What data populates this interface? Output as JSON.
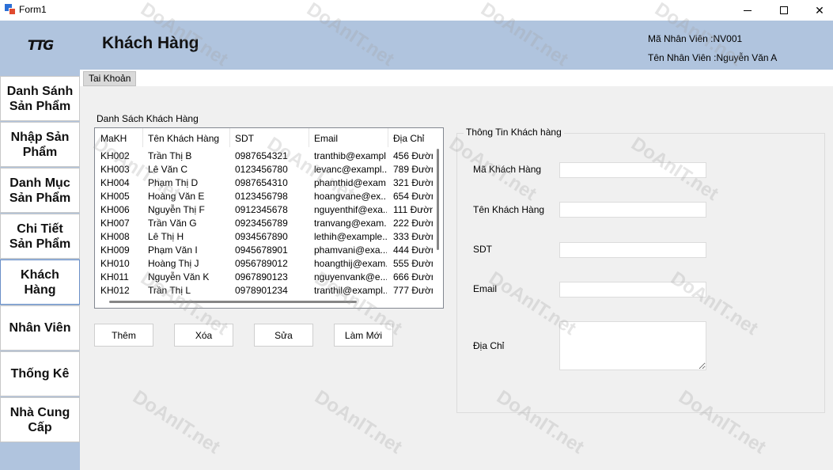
{
  "window": {
    "title": "Form1",
    "icon": "winforms-app-icon",
    "controls": [
      "minimize-icon",
      "maximize-icon",
      "close-icon"
    ]
  },
  "sidebar": {
    "logo_text": "TTG",
    "items": [
      {
        "label": "Danh Sánh\nSản Phẩm"
      },
      {
        "label": "Nhập Sản\nPhẩm"
      },
      {
        "label": "Danh Mục\nSản Phẩm"
      },
      {
        "label": "Chi Tiết\nSản Phẩm"
      },
      {
        "label": "Khách\nHàng",
        "active": true
      },
      {
        "label": "Nhân Viên"
      },
      {
        "label": "Thống Kê"
      },
      {
        "label": "Nhà Cung\nCấp"
      }
    ]
  },
  "header": {
    "title": "Khách Hàng",
    "employee_id": "Mã Nhân Viên :NV001",
    "employee_name": "Tên Nhân Viên :Nguyễn Văn A"
  },
  "tabs": {
    "account": "Tai Khoản"
  },
  "customer_list": {
    "caption": "Danh Sách Khách Hàng",
    "columns": [
      "MaKH",
      "Tên Khách Hàng",
      "SDT",
      "Email",
      "Địa Chỉ"
    ],
    "rows": [
      [
        "KH002",
        "Trần Thị B",
        "0987654321",
        "tranthib@exampl...",
        "456 Đườn"
      ],
      [
        "KH003",
        "Lê Văn C",
        "0123456780",
        "levanc@exampl...",
        "789 Đườn"
      ],
      [
        "KH004",
        "Phạm Thị D",
        "0987654310",
        "phamthid@exam...",
        "321 Đườn"
      ],
      [
        "KH005",
        "Hoàng Văn E",
        "0123456798",
        "hoangvane@ex...",
        "654 Đườn"
      ],
      [
        "KH006",
        "Nguyễn Thị F",
        "0912345678",
        "nguyenthif@exa...",
        "111 Đườn"
      ],
      [
        "KH007",
        "Trần Văn G",
        "0923456789",
        "tranvang@exam...",
        "222 Đườn"
      ],
      [
        "KH008",
        "Lê Thị H",
        "0934567890",
        "lethih@example....",
        "333 Đườn"
      ],
      [
        "KH009",
        "Phạm Văn I",
        "0945678901",
        "phamvani@exa...",
        "444 Đườn"
      ],
      [
        "KH010",
        "Hoàng Thị J",
        "0956789012",
        "hoangthij@exam...",
        "555 Đườn"
      ],
      [
        "KH011",
        "Nguyễn Văn K",
        "0967890123",
        "nguyenvank@e...",
        "666 Đườn"
      ],
      [
        "KH012",
        "Trần Thị L",
        "0978901234",
        "tranthil@exampl...",
        "777 Đườn"
      ]
    ]
  },
  "actions": {
    "add": "Thêm",
    "delete": "Xóa",
    "edit": "Sửa",
    "refresh": "Làm Mới"
  },
  "detail": {
    "caption": "Thông Tin Khách hàng",
    "fields": {
      "id": {
        "label": "Mã Khách Hàng",
        "value": ""
      },
      "name": {
        "label": "Tên Khách Hàng",
        "value": ""
      },
      "phone": {
        "label": "SDT",
        "value": ""
      },
      "email": {
        "label": "Email",
        "value": ""
      },
      "address": {
        "label": "Địa Chỉ",
        "value": ""
      }
    }
  },
  "watermark_text": "DoAnIT.net",
  "colors": {
    "banner": "#b0c4de",
    "background": "#f0f0f0"
  }
}
